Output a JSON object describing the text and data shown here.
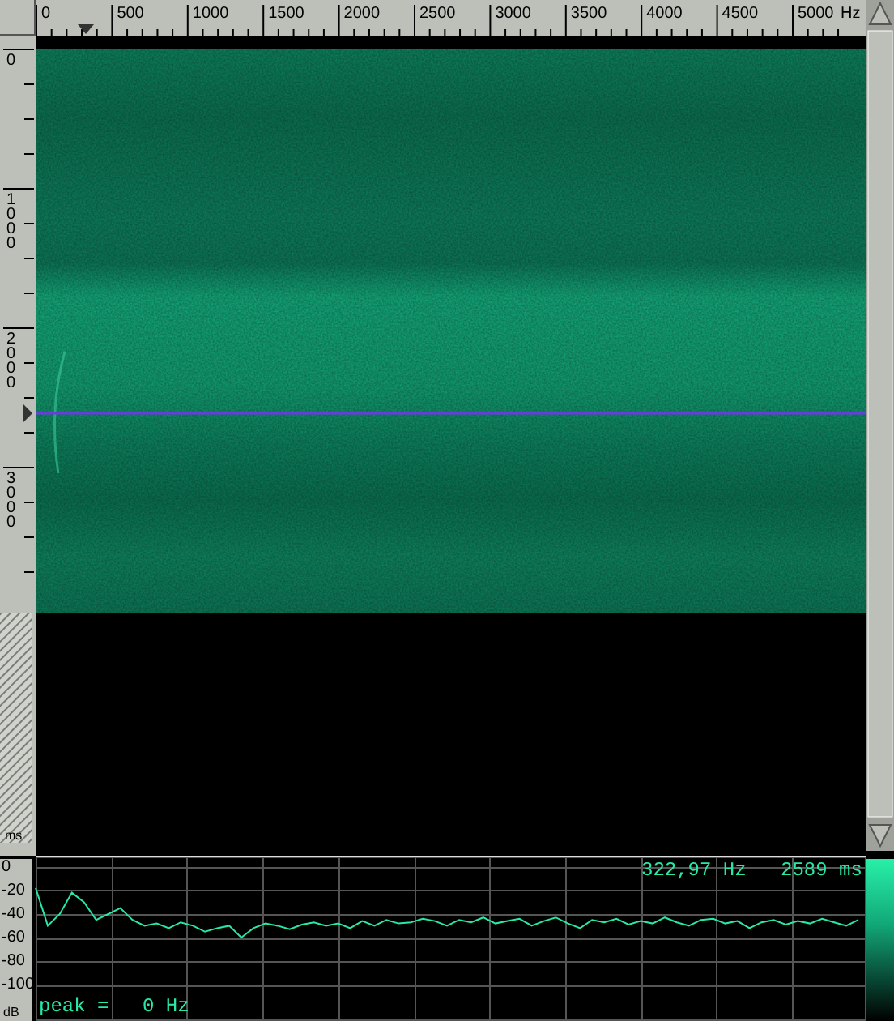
{
  "frequency_ruler": {
    "labels": [
      "0",
      "500",
      "1000",
      "1500",
      "2000",
      "2500",
      "3000",
      "3500",
      "4000",
      "4500",
      "5000"
    ],
    "unit": "Hz"
  },
  "time_ruler": {
    "labels": [
      "0",
      "1000",
      "2000",
      "3000"
    ],
    "unit": "ms"
  },
  "readouts": {
    "frequency": "322,97 Hz",
    "time": "2589 ms"
  },
  "spectrum": {
    "chart_data": {
      "type": "line",
      "ylabel": "dB",
      "grid": true,
      "ylim": [
        -130,
        8
      ],
      "yticks": [
        {
          "value": 0,
          "label": "0"
        },
        {
          "value": -20,
          "label": "-20"
        },
        {
          "value": -40,
          "label": "-40"
        },
        {
          "value": -60,
          "label": "-60"
        },
        {
          "value": -80,
          "label": "-80"
        },
        {
          "value": -100,
          "label": "-100"
        }
      ],
      "categories": [
        null,
        null,
        null,
        null,
        null,
        null,
        null,
        null,
        null,
        null,
        null,
        null,
        null,
        null,
        null,
        null,
        null,
        null,
        null,
        null,
        null,
        null,
        null,
        null,
        null,
        null,
        null,
        null,
        null,
        null,
        null,
        null,
        null,
        null,
        null,
        null,
        null,
        null,
        null,
        null,
        null,
        null,
        null,
        null,
        null,
        null,
        null,
        null,
        null,
        null,
        null,
        null,
        null,
        null,
        null,
        null,
        null,
        null,
        null,
        null,
        null,
        null,
        null,
        null,
        null,
        null,
        null,
        null,
        null
      ],
      "series": [
        {
          "color": "#28e8a8",
          "values": [
            -18,
            -50,
            -40,
            -22,
            -30,
            -45,
            -40,
            -35,
            -45,
            -50,
            -48,
            -52,
            -47,
            -50,
            -55,
            -52,
            -50,
            -60,
            -52,
            -48,
            -50,
            -53,
            -49,
            -47,
            -50,
            -48,
            -52,
            -46,
            -50,
            -45,
            -48,
            -47,
            -44,
            -46,
            -50,
            -45,
            -47,
            -43,
            -48,
            -46,
            -44,
            -50,
            -46,
            -43,
            -48,
            -52,
            -45,
            -47,
            -44,
            -49,
            -46,
            -48,
            -43,
            -47,
            -50,
            -45,
            -44,
            -48,
            -46,
            -52,
            -47,
            -45,
            -49,
            -46,
            -48,
            -44,
            -47,
            -50,
            -45
          ]
        }
      ]
    }
  },
  "peak": {
    "label": "peak =",
    "value": "0 Hz"
  }
}
